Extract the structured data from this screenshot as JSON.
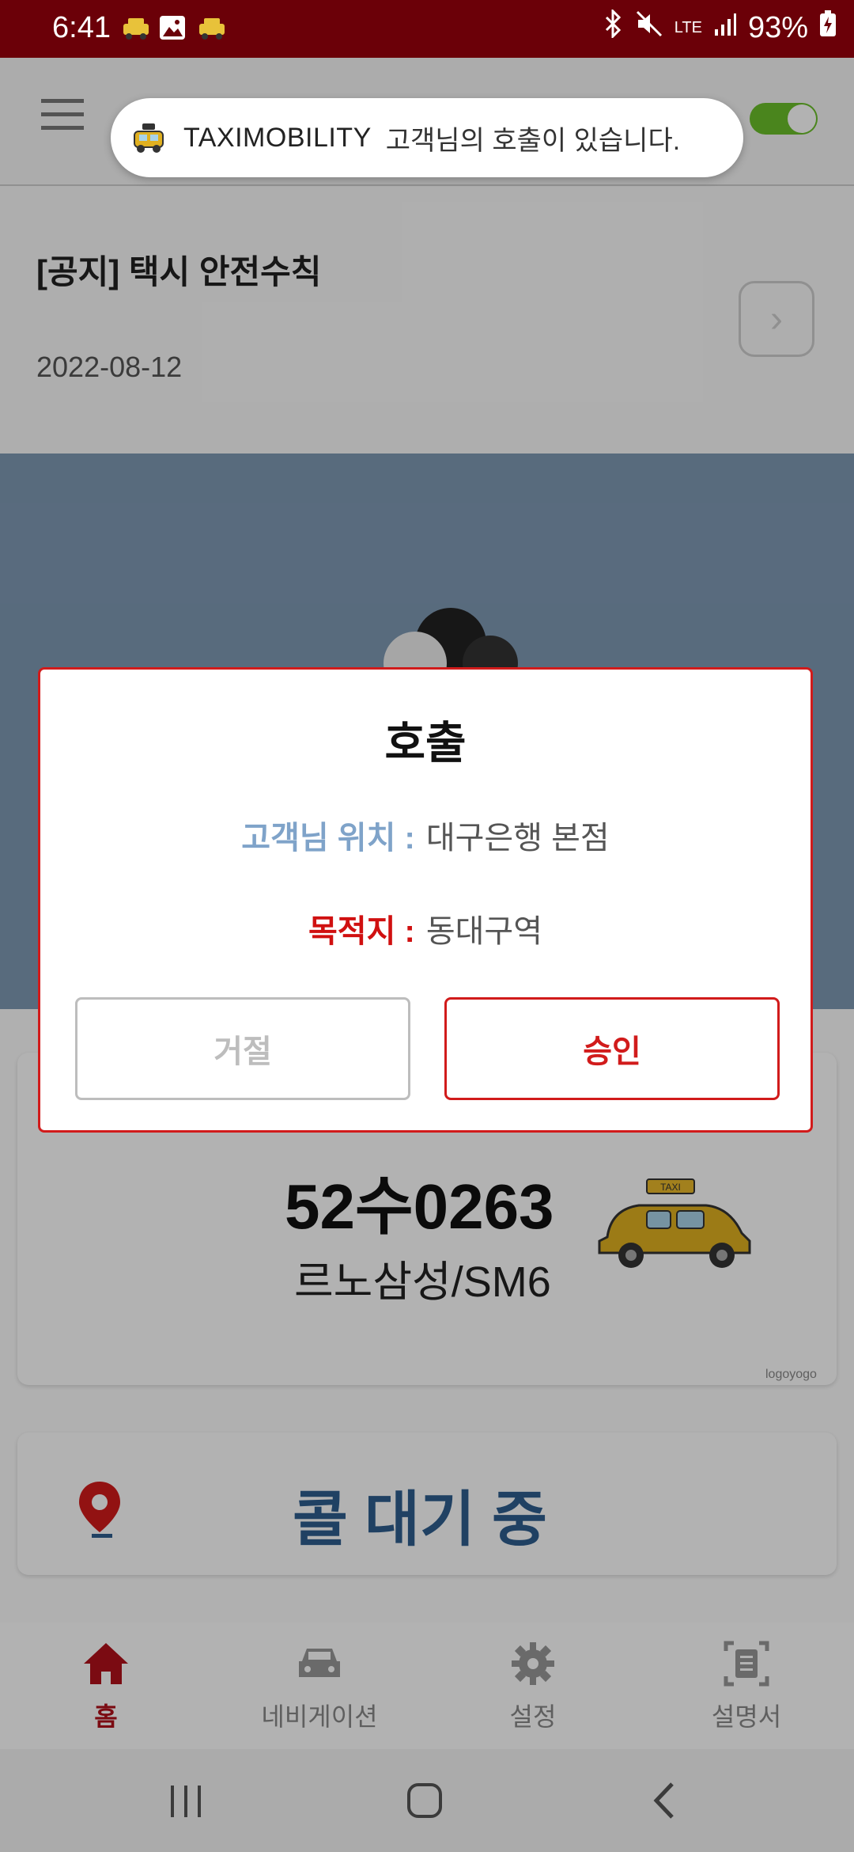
{
  "status_bar": {
    "time": "6:41",
    "network": "LTE",
    "battery": "93%"
  },
  "toast": {
    "app_name": "TAXIMOBILITY",
    "message": "고객님의 호출이 있습니다."
  },
  "notice": {
    "title": "[공지] 택시 안전수칙",
    "date": "2022-08-12"
  },
  "dialog": {
    "title": "호출",
    "pickup_label": "고객님 위치 :",
    "pickup_value": "대구은행 본점",
    "dest_label": "목적지 :",
    "dest_value": "동대구역",
    "reject_label": "거절",
    "approve_label": "승인"
  },
  "vehicle": {
    "plate": "52수0263",
    "model": "르노삼성/SM6",
    "logo_text": "logoyogo",
    "taxi_sign": "TAXI"
  },
  "waiting": {
    "label": "콜 대기 중"
  },
  "bottom_nav": [
    {
      "label": "홈",
      "icon": "home-icon",
      "active": true
    },
    {
      "label": "네비게이션",
      "icon": "car-icon",
      "active": false
    },
    {
      "label": "설정",
      "icon": "gear-icon",
      "active": false
    },
    {
      "label": "설명서",
      "icon": "document-icon",
      "active": false
    }
  ],
  "colors": {
    "brand_red": "#d11b1b",
    "status_bar": "#6b0008",
    "toggle_on": "#6bbf2a",
    "waiting_text": "#2e5e8f"
  }
}
